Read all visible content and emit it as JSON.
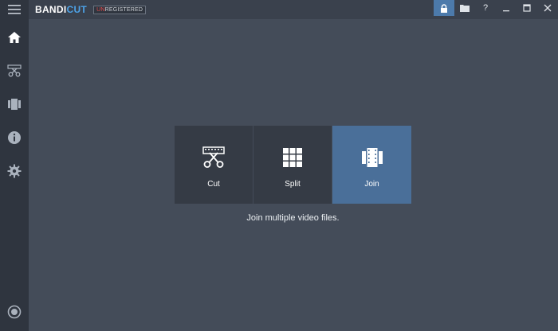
{
  "app": {
    "name_part1": "BANDI",
    "name_part2": "CUT",
    "badge_red": "UN",
    "badge_rest": "REGISTERED"
  },
  "window_buttons": [
    "lock-icon",
    "folder-icon",
    "help-icon",
    "minimize-icon",
    "maximize-icon",
    "close-icon"
  ],
  "window_labels": {
    "help": "?"
  },
  "sidebar": {
    "items": [
      "home-icon",
      "cut-tool-icon",
      "join-tool-icon",
      "info-icon",
      "settings-icon"
    ],
    "bottom": "record-icon"
  },
  "modes": [
    {
      "label": "Cut",
      "icon": "scissors-film-icon",
      "active": false
    },
    {
      "label": "Split",
      "icon": "grid-split-icon",
      "active": false
    },
    {
      "label": "Join",
      "icon": "film-join-icon",
      "active": true
    }
  ],
  "description": "Join multiple video files.",
  "colors": {
    "accent": "#4da3e8",
    "active_panel": "#4a6f99",
    "background": "#444c59",
    "sidebar": "#2f353f"
  }
}
